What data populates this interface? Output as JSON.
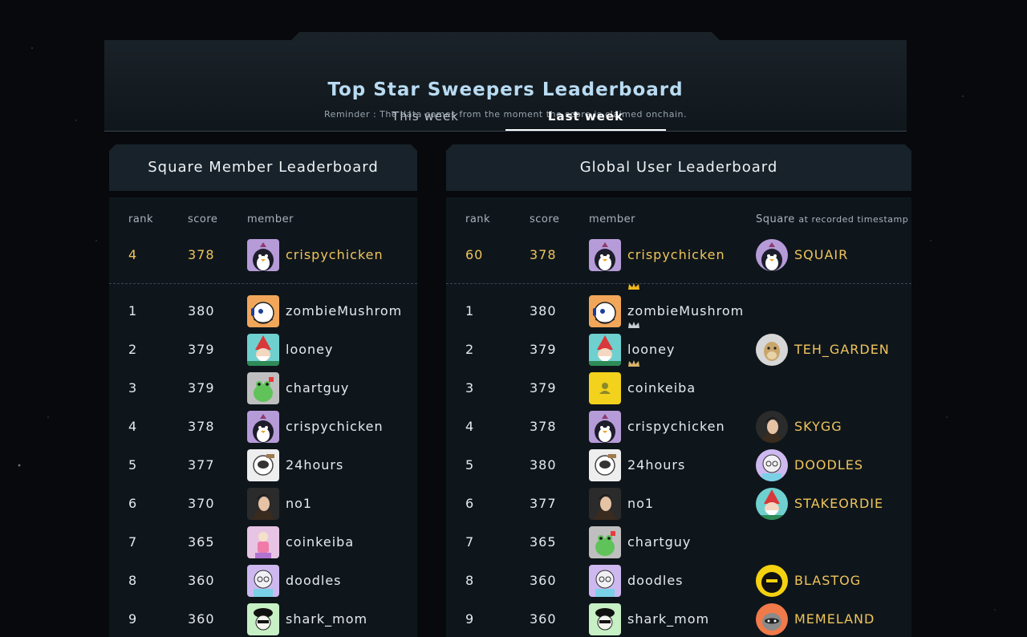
{
  "title": "Top Star Sweepers Leaderboard",
  "subtitle": "Reminder : The data comes from the moment the score is claimed onchain.",
  "tabs": [
    {
      "label": "This week",
      "active": false
    },
    {
      "label": "Last week",
      "active": true
    }
  ],
  "square_board": {
    "title": "Square Member Leaderboard",
    "columns": {
      "rank": "rank",
      "score": "score",
      "member": "member"
    },
    "my_row": {
      "rank": "4",
      "score": "378",
      "member": "crispychicken",
      "avatar": "penguin-avatar"
    },
    "rows": [
      {
        "rank": "1",
        "score": "380",
        "member": "zombieMushrom",
        "avatar": "headset-avatar"
      },
      {
        "rank": "2",
        "score": "379",
        "member": "looney",
        "avatar": "gnome-avatar"
      },
      {
        "rank": "3",
        "score": "379",
        "member": "chartguy",
        "avatar": "frog-avatar"
      },
      {
        "rank": "4",
        "score": "378",
        "member": "crispychicken",
        "avatar": "penguin-avatar"
      },
      {
        "rank": "5",
        "score": "377",
        "member": "24hours",
        "avatar": "astronaut-avatar"
      },
      {
        "rank": "6",
        "score": "370",
        "member": "no1",
        "avatar": "portrait-avatar"
      },
      {
        "rank": "7",
        "score": "365",
        "member": "coinkeiba",
        "avatar": "figure-avatar"
      },
      {
        "rank": "8",
        "score": "360",
        "member": "doodles",
        "avatar": "doodle-avatar"
      },
      {
        "rank": "9",
        "score": "360",
        "member": "shark_mom",
        "avatar": "beret-avatar"
      }
    ]
  },
  "global_board": {
    "title": "Global User Leaderboard",
    "columns": {
      "rank": "rank",
      "score": "score",
      "member": "member",
      "square": "Square",
      "square_suffix": "at recorded timestamp"
    },
    "my_row": {
      "rank": "60",
      "score": "378",
      "member": "crispychicken",
      "avatar": "penguin-avatar",
      "square": "SQUAIR",
      "square_avatar": "penguin-avatar"
    },
    "rows": [
      {
        "rank": "1",
        "score": "380",
        "member": "zombieMushrom",
        "avatar": "headset-avatar",
        "crown": "gold",
        "square": "",
        "square_avatar": ""
      },
      {
        "rank": "2",
        "score": "379",
        "member": "looney",
        "avatar": "gnome-avatar",
        "crown": "silver",
        "square": "TEH_GARDEN",
        "square_avatar": "ape-avatar"
      },
      {
        "rank": "3",
        "score": "379",
        "member": "coinkeiba",
        "avatar": "default-user-avatar",
        "crown": "bronze",
        "square": "",
        "square_avatar": ""
      },
      {
        "rank": "4",
        "score": "378",
        "member": "crispychicken",
        "avatar": "penguin-avatar",
        "square": "SKYGG",
        "square_avatar": "portrait-avatar"
      },
      {
        "rank": "5",
        "score": "380",
        "member": "24hours",
        "avatar": "astronaut-avatar",
        "square": "DOODLES",
        "square_avatar": "doodle-avatar"
      },
      {
        "rank": "6",
        "score": "377",
        "member": "no1",
        "avatar": "portrait-avatar",
        "square": "STAKEORDIE",
        "square_avatar": "gnome-avatar"
      },
      {
        "rank": "7",
        "score": "365",
        "member": "chartguy",
        "avatar": "frog-avatar",
        "square": "",
        "square_avatar": ""
      },
      {
        "rank": "8",
        "score": "360",
        "member": "doodles",
        "avatar": "doodle-avatar",
        "square": "BLASTOG",
        "square_avatar": "blast-avatar"
      },
      {
        "rank": "9",
        "score": "360",
        "member": "shark_mom",
        "avatar": "beret-avatar",
        "square": "MEMELAND",
        "square_avatar": "raccoon-avatar"
      }
    ]
  },
  "colors": {
    "accent_gold": "#f0c45c",
    "title_blue": "#b9dbf2",
    "crown_gold": "#f2b81c",
    "crown_silver": "#c9ced3",
    "crown_bronze": "#d9b36a"
  }
}
